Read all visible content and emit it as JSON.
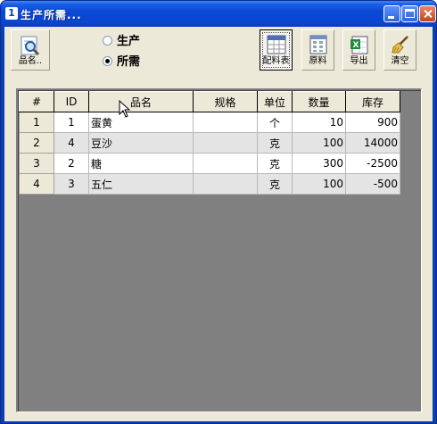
{
  "window": {
    "title": "生产所需...",
    "icon_glyph": "1",
    "controls": [
      "minimize-icon",
      "maximize-icon",
      "close-icon"
    ]
  },
  "toolbar": {
    "search_label": "品名..",
    "recipe_label": "配料表",
    "material_label": "原料",
    "export_label": "导出",
    "clear_label": "清空"
  },
  "mode": {
    "options": [
      {
        "label": "生产",
        "selected": false
      },
      {
        "label": "所需",
        "selected": true
      }
    ]
  },
  "grid": {
    "columns": [
      "#",
      "ID",
      "品名",
      "规格",
      "单位",
      "数量",
      "库存"
    ],
    "rows": [
      {
        "num": "1",
        "id": "1",
        "name": "蛋黄",
        "spec": "",
        "unit": "个",
        "qty": "10",
        "stock": "900"
      },
      {
        "num": "2",
        "id": "4",
        "name": "豆沙",
        "spec": "",
        "unit": "克",
        "qty": "100",
        "stock": "14000"
      },
      {
        "num": "3",
        "id": "2",
        "name": "糖",
        "spec": "",
        "unit": "克",
        "qty": "300",
        "stock": "-2500"
      },
      {
        "num": "4",
        "id": "3",
        "name": "五仁",
        "spec": "",
        "unit": "克",
        "qty": "100",
        "stock": "-500"
      }
    ]
  },
  "colors": {
    "titlebar": "#0a46d0",
    "client": "#ece9d8",
    "grid_empty": "#808080"
  }
}
